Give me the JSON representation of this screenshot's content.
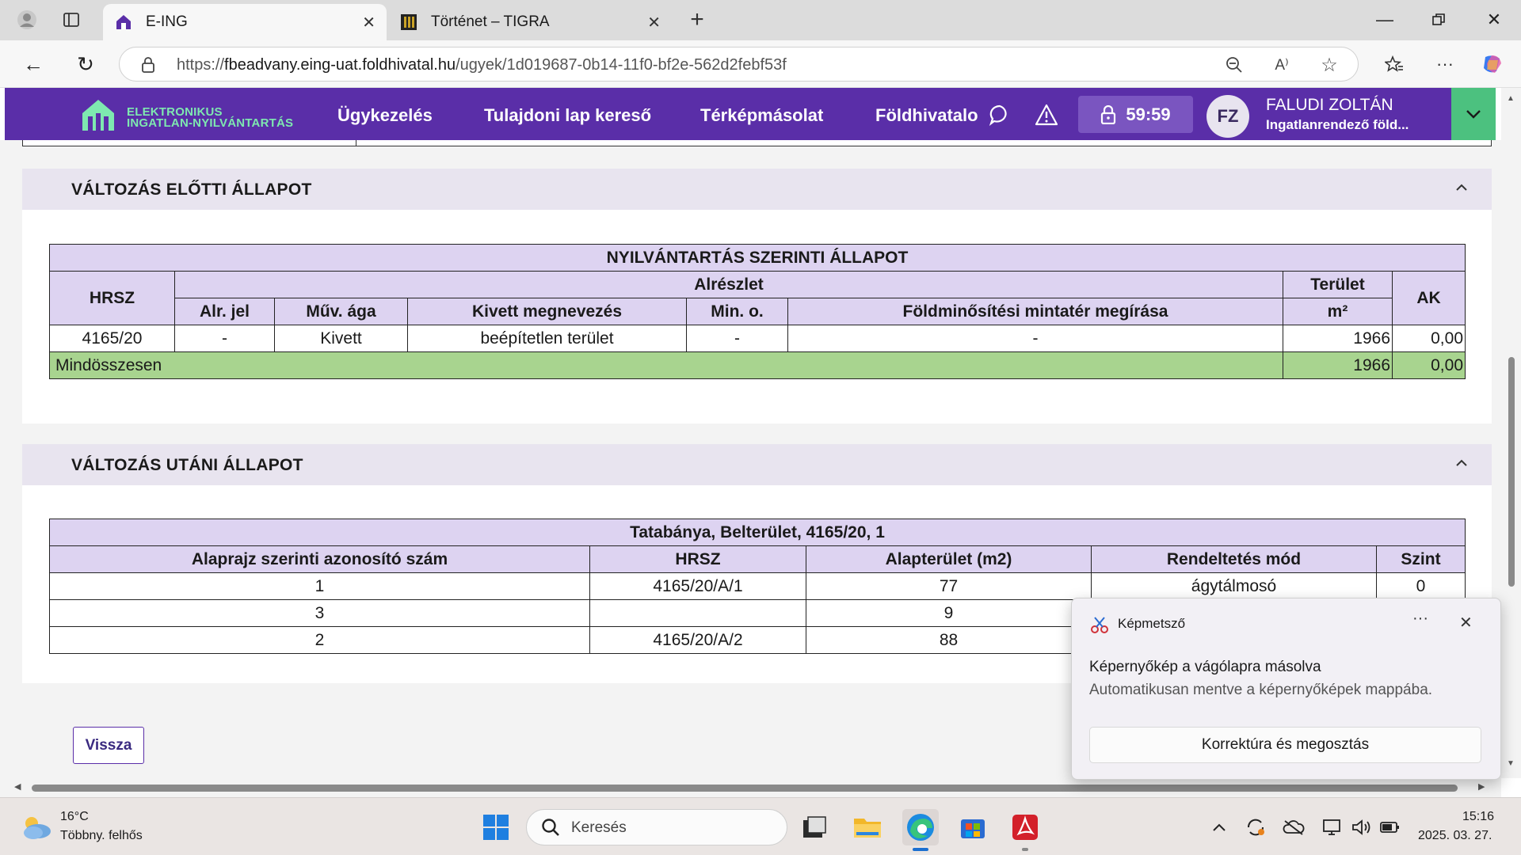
{
  "browser": {
    "tabs": [
      {
        "title": "E-ING"
      },
      {
        "title": "Történet – TIGRA"
      }
    ],
    "url_prefix": "https://",
    "url_host": "fbeadvany.eing-uat.foldhivatal.hu",
    "url_path": "/ugyek/1d019687-0b14-11f0-bf2e-562d2febf53f",
    "new_tab_label": "+",
    "close_glyph": "✕"
  },
  "app": {
    "brand_line1": "ELEKTRONIKUS",
    "brand_line2": "INGATLAN-NYILVÁNTARTÁS",
    "menu": [
      "Ügykezelés",
      "Tulajdoni lap kereső",
      "Térképmásolat",
      "Földhivatalo"
    ],
    "timer": "59:59",
    "user_initials": "FZ",
    "user_name": "FALUDI ZOLTÁN",
    "user_role": "Ingatlanrendező föld...",
    "colors": {
      "header": "#5a2ea8",
      "brand_text": "#7ee8b0",
      "dropdown": "#4cc17f",
      "table_header": "#ddd3f1",
      "total_row": "#a8d48f"
    }
  },
  "before_section": {
    "title": "VÁLTOZÁS ELŐTTI ÁLLAPOT",
    "table_title": "NYILVÁNTARTÁS SZERINTI ÁLLAPOT",
    "headers": {
      "hrsz": "HRSZ",
      "alreszlet": "Alrészlet",
      "terulet": "Terület",
      "terulet_unit": "m²",
      "ak": "AK",
      "alr_jel": "Alr. jel",
      "muv_aga": "Műv. ága",
      "kivett": "Kivett megnevezés",
      "min_o": "Min. o.",
      "foldminosites": "Földminősítési mintatér megírása"
    },
    "row": {
      "hrsz": "4165/20",
      "alr_jel": "-",
      "muv_aga": "Kivett",
      "kivett": "beépítetlen terület",
      "min_o": "-",
      "foldminosites": "-",
      "terulet": "1966",
      "ak": "0,00"
    },
    "total": {
      "label": "Mindösszesen",
      "terulet": "1966",
      "ak": "0,00"
    }
  },
  "after_section": {
    "title": "VÁLTOZÁS UTÁNI ÁLLAPOT",
    "table_title": "Tatabánya, Belterület, 4165/20, 1",
    "headers": [
      "Alaprajz szerinti azonosító szám",
      "HRSZ",
      "Alapterület (m2)",
      "Rendeltetés mód",
      "Szint"
    ],
    "rows": [
      [
        "1",
        "4165/20/A/1",
        "77",
        "ágytálmosó",
        "0"
      ],
      [
        "3",
        "",
        "9",
        "",
        ""
      ],
      [
        "2",
        "4165/20/A/2",
        "88",
        "",
        ""
      ]
    ]
  },
  "back_button": "Vissza",
  "toast": {
    "app": "Képmetsző",
    "more": "···",
    "title": "Képernyőkép a vágólapra másolva",
    "subtitle": "Automatikusan mentve a képernyőképek mappába.",
    "action": "Korrektúra és megosztás"
  },
  "taskbar": {
    "weather_temp": "16°C",
    "weather_desc": "Többny. felhős",
    "search_placeholder": "Keresés",
    "time": "15:16",
    "date": "2025. 03. 27."
  }
}
